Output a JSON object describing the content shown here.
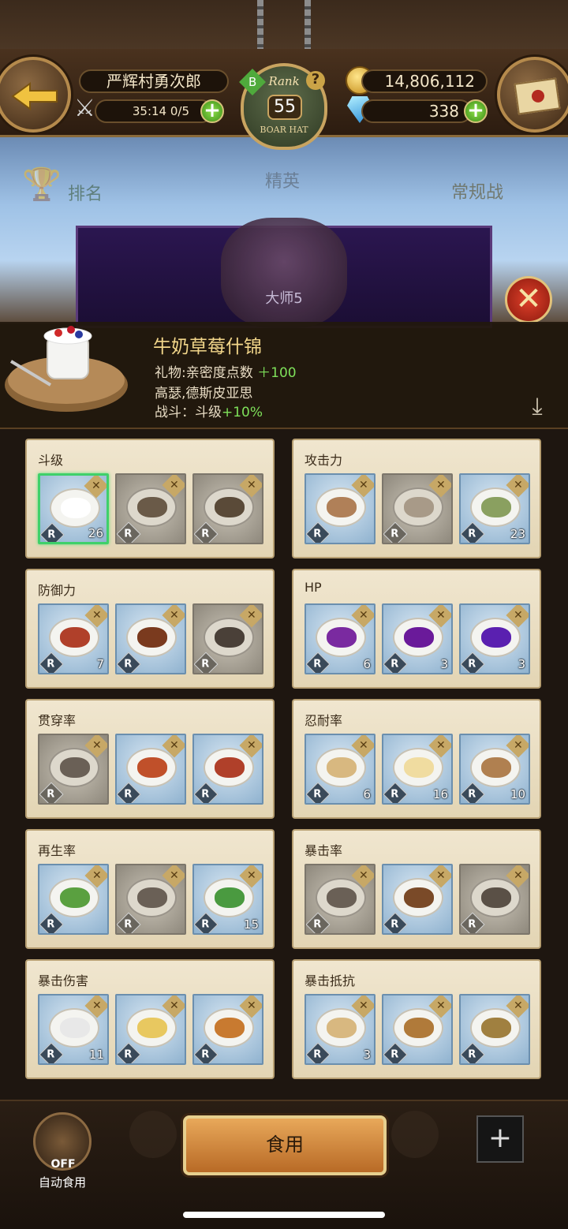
{
  "header": {
    "player_name": "严辉村勇次郎",
    "stamina": "35:14 0/5",
    "gold": "14,806,112",
    "gems": "338",
    "rank_label": "Rank",
    "rank_value": "55",
    "rank_title": "BOAR HAT",
    "b_badge": "B",
    "help_glyph": "?"
  },
  "subtabs": {
    "ranking": "排名",
    "elite": "精英",
    "normal": "常规战"
  },
  "banner": {
    "tier": "大师5"
  },
  "detail": {
    "title": "牛奶草莓什锦",
    "line1_label": "礼物:亲密度点数",
    "line1_value": "＋100",
    "line2": "高瑟,德斯皮亚思",
    "line3_label": "战斗：斗级",
    "line3_value": "+10%"
  },
  "categories": [
    {
      "title": "斗级",
      "slots": [
        {
          "state": "selected",
          "count": "26",
          "food": "#ffffff"
        },
        {
          "state": "gray",
          "count": "",
          "food": "#6a5a48"
        },
        {
          "state": "gray",
          "count": "",
          "food": "#5a4a38"
        }
      ]
    },
    {
      "title": "攻击力",
      "slots": [
        {
          "state": "normal",
          "count": "",
          "food": "#b08058"
        },
        {
          "state": "gray",
          "count": "",
          "food": "#a89a88"
        },
        {
          "state": "normal",
          "count": "23",
          "food": "#8aa060"
        }
      ]
    },
    {
      "title": "防御力",
      "slots": [
        {
          "state": "normal",
          "count": "7",
          "food": "#b0402a"
        },
        {
          "state": "normal",
          "count": "",
          "food": "#7a3a1e"
        },
        {
          "state": "gray",
          "count": "",
          "food": "#4a4038"
        }
      ]
    },
    {
      "title": "HP",
      "slots": [
        {
          "state": "normal",
          "count": "6",
          "food": "#7a2aa0"
        },
        {
          "state": "normal",
          "count": "3",
          "food": "#6a1a9a"
        },
        {
          "state": "normal",
          "count": "3",
          "food": "#5a20b0"
        }
      ]
    },
    {
      "title": "贯穿率",
      "slots": [
        {
          "state": "gray",
          "count": "",
          "food": "#6a6056"
        },
        {
          "state": "normal",
          "count": "",
          "food": "#c0502a"
        },
        {
          "state": "normal",
          "count": "",
          "food": "#b0402a"
        }
      ]
    },
    {
      "title": "忍耐率",
      "slots": [
        {
          "state": "normal",
          "count": "6",
          "food": "#d8b880"
        },
        {
          "state": "normal",
          "count": "16",
          "food": "#f0dca0"
        },
        {
          "state": "normal",
          "count": "10",
          "food": "#b08050"
        }
      ]
    },
    {
      "title": "再生率",
      "slots": [
        {
          "state": "normal",
          "count": "",
          "food": "#5aa040"
        },
        {
          "state": "gray",
          "count": "",
          "food": "#6a6056"
        },
        {
          "state": "normal",
          "count": "15",
          "food": "#4a9a40"
        }
      ]
    },
    {
      "title": "暴击率",
      "slots": [
        {
          "state": "gray",
          "count": "",
          "food": "#6a6056"
        },
        {
          "state": "normal",
          "count": "",
          "food": "#7a4a28"
        },
        {
          "state": "gray",
          "count": "",
          "food": "#5a5046"
        }
      ]
    },
    {
      "title": "暴击伤害",
      "slots": [
        {
          "state": "normal",
          "count": "11",
          "food": "#e8e8e8"
        },
        {
          "state": "normal",
          "count": "",
          "food": "#e8c860"
        },
        {
          "state": "normal",
          "count": "",
          "food": "#c87a30"
        }
      ]
    },
    {
      "title": "暴击抵抗",
      "slots": [
        {
          "state": "normal",
          "count": "3",
          "food": "#d8b880"
        },
        {
          "state": "normal",
          "count": "",
          "food": "#b07a3a"
        },
        {
          "state": "normal",
          "count": "",
          "food": "#a08040"
        }
      ]
    }
  ],
  "bottom": {
    "auto_state": "OFF",
    "auto_label": "自动食用",
    "eat_label": "食用",
    "add_glyph": "+"
  },
  "icons": {
    "r_badge": "R",
    "fork_glyph": "✕",
    "close_glyph": "✕",
    "download_glyph": "⤓",
    "sword_glyph": "⚔",
    "plus_glyph": "+"
  }
}
